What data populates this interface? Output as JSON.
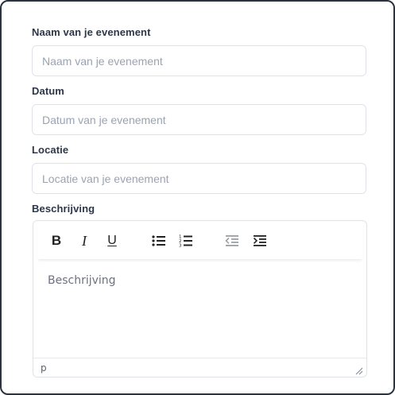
{
  "form": {
    "name": {
      "label": "Naam van je evenement",
      "placeholder": "Naam van je evenement",
      "value": ""
    },
    "date": {
      "label": "Datum",
      "placeholder": "Datum van je evenement",
      "value": ""
    },
    "location": {
      "label": "Locatie",
      "placeholder": "Locatie van je evenement",
      "value": ""
    },
    "description": {
      "label": "Beschrijving",
      "placeholder": "Beschrijving",
      "toolbar": {
        "bold": "B",
        "italic": "I",
        "underline": "U",
        "icons": [
          "bold-icon",
          "italic-icon",
          "underline-icon",
          "bullet-list-icon",
          "numbered-list-icon",
          "outdent-icon",
          "indent-icon"
        ]
      },
      "status_path": "p"
    }
  },
  "colors": {
    "frame_border": "#2b3340",
    "label": "#2d3748",
    "placeholder": "#9aa3b0",
    "input_border": "#dfe3e9"
  }
}
